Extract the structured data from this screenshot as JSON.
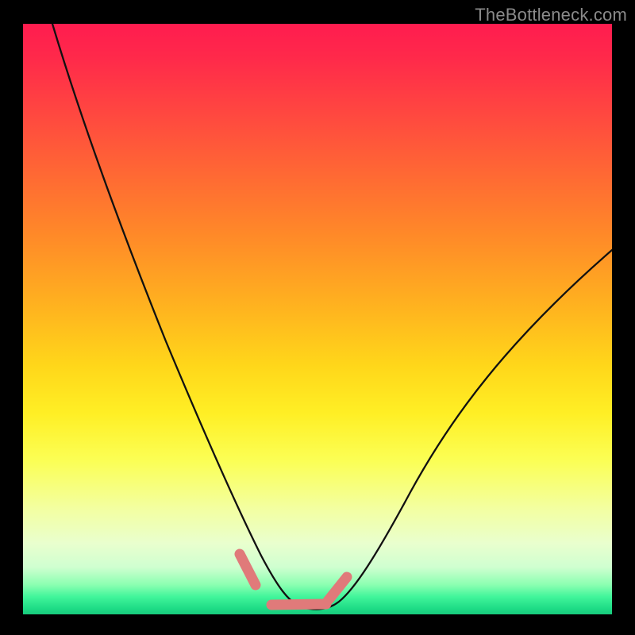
{
  "watermark": "TheBottleneck.com",
  "chart_data": {
    "type": "line",
    "title": "",
    "xlabel": "",
    "ylabel": "",
    "xlim": [
      0,
      100
    ],
    "ylim": [
      0,
      100
    ],
    "grid": false,
    "legend": false,
    "series": [
      {
        "name": "curve",
        "x": [
          5,
          8,
          12,
          16,
          20,
          24,
          28,
          32,
          35,
          37,
          39,
          41,
          43,
          45,
          48,
          51,
          54,
          58,
          63,
          69,
          76,
          84,
          92,
          100
        ],
        "y": [
          100,
          91,
          80,
          69,
          58,
          47,
          36,
          25,
          16,
          11,
          7,
          4,
          2,
          1,
          0.7,
          0.7,
          2,
          6,
          12,
          20,
          30,
          41,
          52,
          62
        ]
      }
    ],
    "markers": [
      {
        "name": "marker-left",
        "x": [
          36.8,
          39.5
        ],
        "y": [
          10.2,
          5.0
        ]
      },
      {
        "name": "marker-floor",
        "x": [
          42.0,
          51.5
        ],
        "y": [
          1.6,
          1.8
        ]
      },
      {
        "name": "marker-right",
        "x": [
          51.8,
          55.0
        ],
        "y": [
          2.2,
          6.3
        ]
      }
    ],
    "colors": {
      "curve": "#111111",
      "marker": "#e07a7a"
    }
  }
}
